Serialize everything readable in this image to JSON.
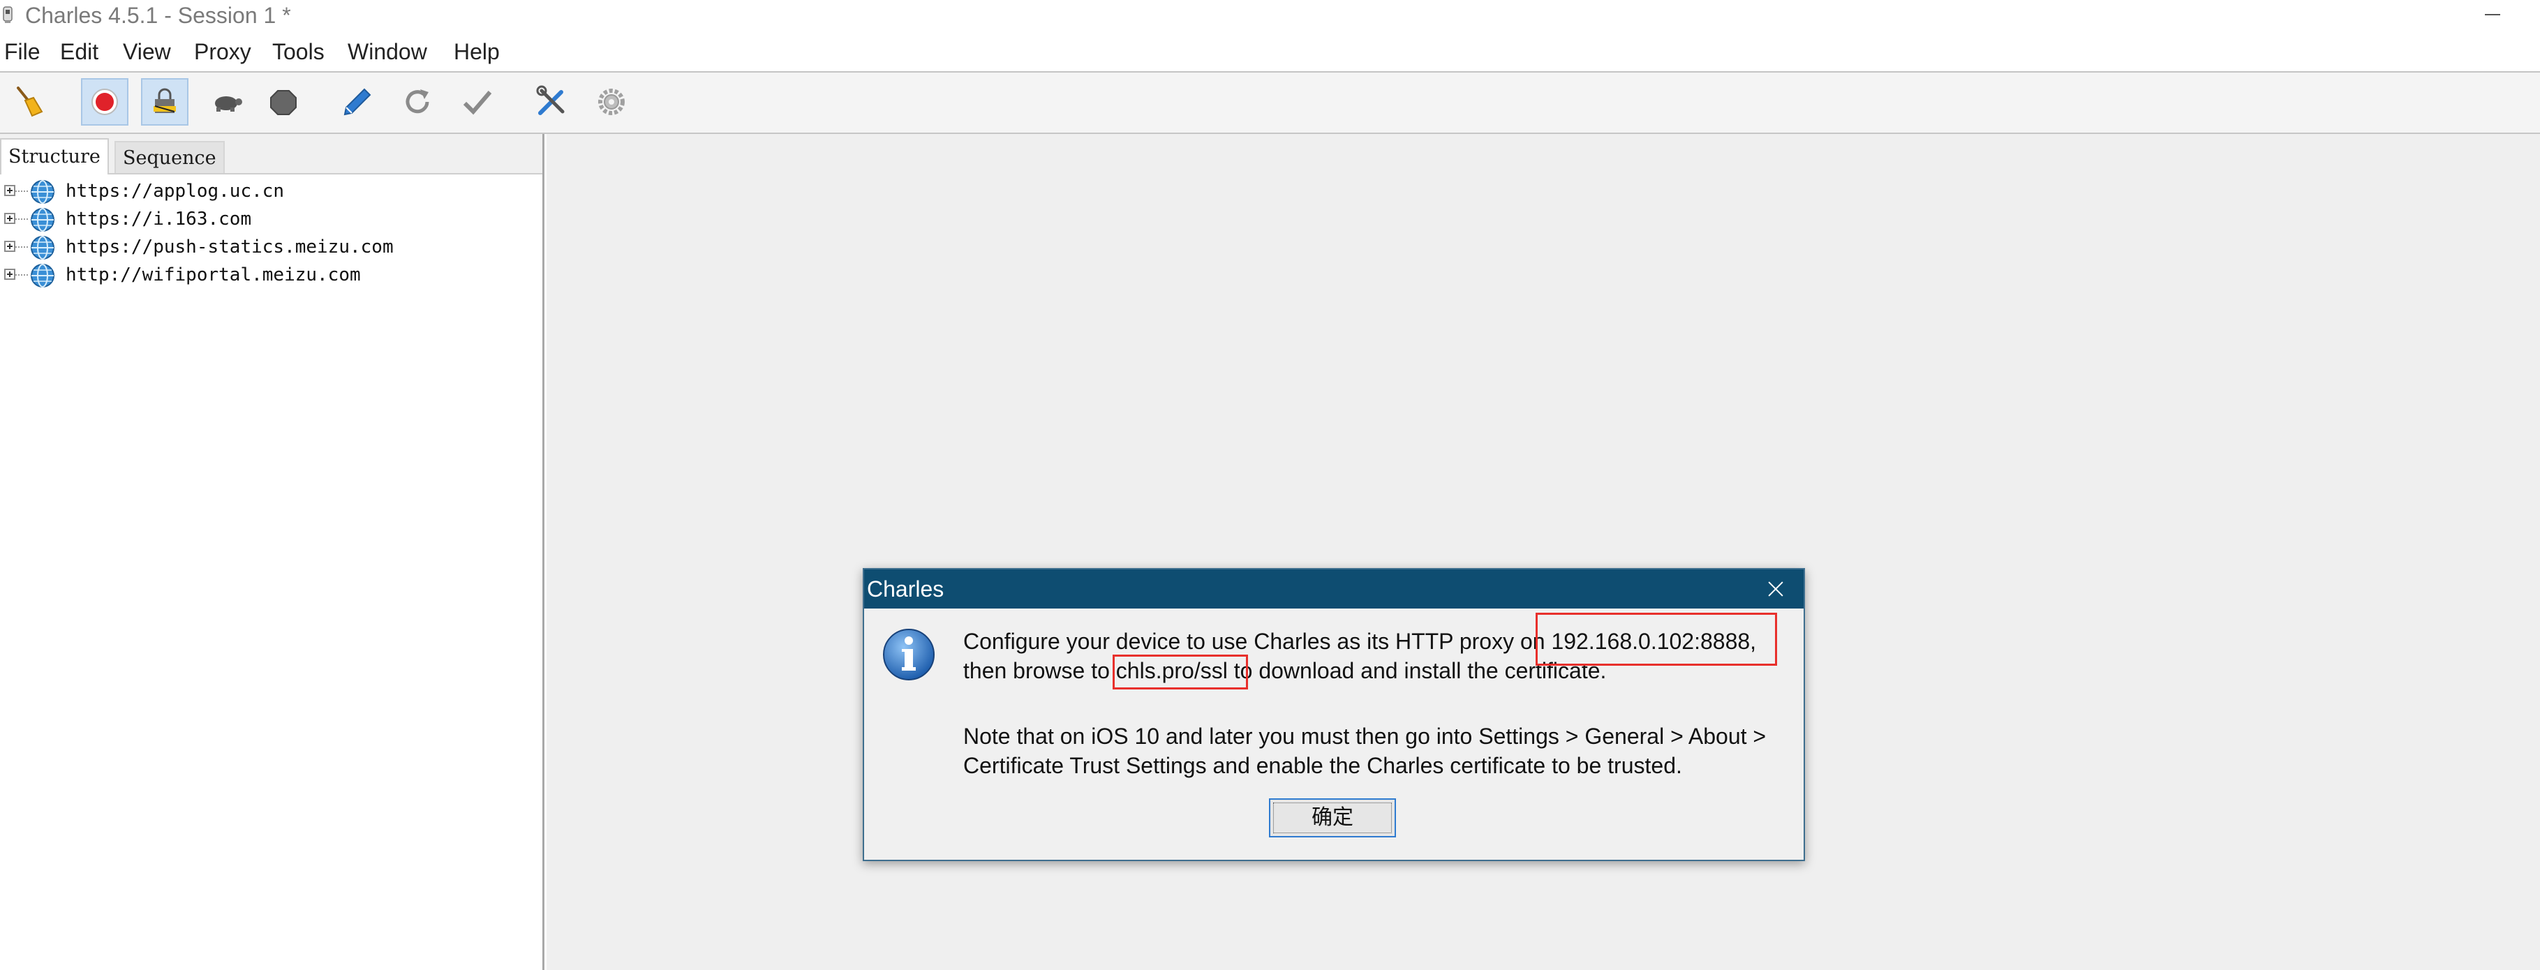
{
  "window": {
    "title": "Charles 4.5.1 - Session 1 *"
  },
  "menu": [
    "File",
    "Edit",
    "View",
    "Proxy",
    "Tools",
    "Window",
    "Help"
  ],
  "toolbar": {
    "buttons": [
      {
        "name": "broom-icon",
        "active": false
      },
      {
        "name": "record-icon",
        "active": true
      },
      {
        "name": "ssl-proxying-icon",
        "active": true
      },
      {
        "name": "throttle-turtle-icon",
        "active": false
      },
      {
        "name": "breakpoints-icon",
        "active": false
      },
      {
        "name": "compose-pen-icon",
        "active": false
      },
      {
        "name": "repeat-icon",
        "active": false
      },
      {
        "name": "validate-check-icon",
        "active": false
      },
      {
        "name": "tools-icon",
        "active": false
      },
      {
        "name": "settings-gear-icon",
        "active": false
      }
    ]
  },
  "left_panel": {
    "tabs": [
      "Structure",
      "Sequence"
    ],
    "selected_tab": "Structure",
    "hosts": [
      "https://applog.uc.cn",
      "https://i.163.com",
      "https://push-statics.meizu.com",
      "http://wifiportal.meizu.com"
    ]
  },
  "dialog": {
    "title": "Charles",
    "line1_before": "Configure your device to use Charles as its HTTP proxy on ",
    "line1_value": "192.168.0.102:8888,",
    "line2_before": "then browse to ",
    "line2_value": "chls.pro/ssl",
    "line2_after": " to download and install the certificate.",
    "line3": "Note that on iOS 10 and later you must then go into Settings > General > About >",
    "line4": "Certificate Trust Settings and enable the Charles certificate to be trusted.",
    "ok_label": "确定"
  },
  "colors": {
    "dialog_title_bg": "#0e4d71",
    "highlight_box": "#e8302c",
    "record_red": "#e0222a",
    "active_tool_bg": "#cfe2f5"
  }
}
